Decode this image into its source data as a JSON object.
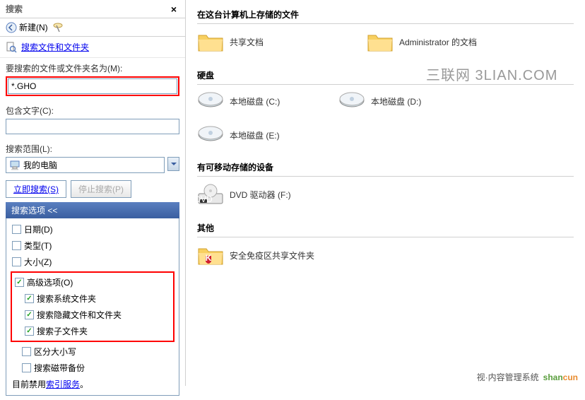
{
  "leftPanel": {
    "title": "搜索",
    "newBtn": "新建(N)",
    "searchFilesLink": "搜索文件和文件夹",
    "filenameLabel": "要搜索的文件或文件夹名为(M):",
    "filenameValue": "*.GHO",
    "containsLabel": "包含文字(C):",
    "containsValue": "",
    "scopeLabel": "搜索范围(L):",
    "scopeValue": "我的电脑",
    "searchBtn": "立即搜索(S)",
    "stopBtn": "停止搜索(P)",
    "optionsHeader": "搜索选项 <<",
    "options": {
      "date": "日期(D)",
      "type": "类型(T)",
      "size": "大小(Z)",
      "advanced": "高级选项(O)",
      "searchSystem": "搜索系统文件夹",
      "searchHidden": "搜索隐藏文件和文件夹",
      "searchSub": "搜索子文件夹",
      "caseSensitive": "区分大小写",
      "searchTape": "搜索磁带备份"
    },
    "indexText": "目前禁用",
    "indexLink": "索引服务"
  },
  "rightPanel": {
    "header": "在这台计算机上存储的文件",
    "folders": [
      {
        "label": "共享文档"
      },
      {
        "label": "Administrator 的文档"
      }
    ],
    "drivesHeader": "硬盘",
    "drives": [
      {
        "label": "本地磁盘 (C:)"
      },
      {
        "label": "本地磁盘 (D:)"
      },
      {
        "label": "本地磁盘 (E:)"
      }
    ],
    "removableHeader": "有可移动存储的设备",
    "removable": [
      {
        "label": "DVD 驱动器 (F:)"
      }
    ],
    "otherHeader": "其他",
    "other": [
      {
        "label": "安全免疫区共享文件夹"
      }
    ]
  },
  "watermark": "三联网 3LIAN.COM",
  "bottomLabel": "视·内容管理系统",
  "logo1": "shan",
  "logo2": "cun"
}
